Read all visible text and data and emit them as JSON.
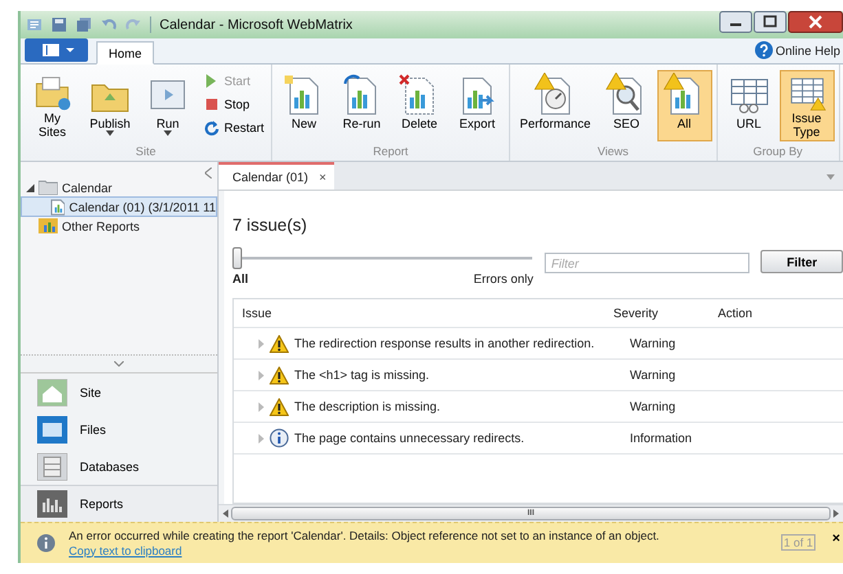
{
  "window": {
    "title": "Calendar - Microsoft WebMatrix"
  },
  "ribbon": {
    "tabs": [
      {
        "label": "Home",
        "selected": true
      }
    ],
    "help": "Online Help",
    "groups": [
      {
        "label": "Site",
        "items": [
          {
            "label": "My Sites",
            "kind": "large",
            "selected": false,
            "disabled": false,
            "dropdown": false
          },
          {
            "label": "Publish",
            "kind": "large",
            "selected": false,
            "disabled": false,
            "dropdown": true
          },
          {
            "label": "Run",
            "kind": "large",
            "selected": false,
            "disabled": false,
            "dropdown": true
          },
          {
            "label": "Start",
            "kind": "small",
            "disabled": true
          },
          {
            "label": "Stop",
            "kind": "small",
            "disabled": false
          },
          {
            "label": "Restart",
            "kind": "small",
            "disabled": false
          }
        ]
      },
      {
        "label": "Report",
        "items": [
          {
            "label": "New",
            "kind": "large",
            "selected": false,
            "disabled": false,
            "dropdown": false
          },
          {
            "label": "Re-run",
            "kind": "large",
            "selected": false,
            "disabled": false,
            "dropdown": false
          },
          {
            "label": "Delete",
            "kind": "large",
            "selected": false,
            "disabled": false,
            "dropdown": false
          },
          {
            "label": "Export",
            "kind": "large",
            "selected": false,
            "disabled": false,
            "dropdown": false
          }
        ]
      },
      {
        "label": "Views",
        "items": [
          {
            "label": "Performance",
            "kind": "large",
            "selected": false,
            "disabled": false,
            "dropdown": false
          },
          {
            "label": "SEO",
            "kind": "large",
            "selected": false,
            "disabled": false,
            "dropdown": false
          },
          {
            "label": "All",
            "kind": "large",
            "selected": true,
            "disabled": false,
            "dropdown": false
          }
        ]
      },
      {
        "label": "Group By",
        "items": [
          {
            "label": "URL",
            "kind": "large",
            "selected": false,
            "disabled": false,
            "dropdown": false
          },
          {
            "label": "Issue Type",
            "kind": "large",
            "selected": true,
            "disabled": false,
            "dropdown": false
          }
        ]
      }
    ]
  },
  "sidebar": {
    "tree": [
      {
        "label": "Calendar",
        "expanded": true,
        "selected": false,
        "children": [
          {
            "label": "Calendar (01) (3/1/2011 11",
            "selected": true
          }
        ]
      },
      {
        "label": "Other Reports",
        "selected": false
      }
    ],
    "nav": [
      {
        "label": "Site",
        "selected": false
      },
      {
        "label": "Files",
        "selected": false
      },
      {
        "label": "Databases",
        "selected": false
      },
      {
        "label": "Reports",
        "selected": true
      }
    ]
  },
  "document_tabs": [
    {
      "label": "Calendar (01)",
      "selected": true,
      "close": "×"
    }
  ],
  "report": {
    "count": "7 issue(s)",
    "slider": {
      "level": 0,
      "min_label": "All",
      "max_label": "Errors only"
    },
    "filter": {
      "placeholder": "Filter"
    },
    "filter_button": "Filter",
    "table": {
      "columns": [
        "Issue",
        "Severity",
        "Action"
      ],
      "rows": [
        {
          "kind": "warning",
          "issue": "The redirection response results in another redirection.",
          "severity": "Warning"
        },
        {
          "kind": "warning",
          "issue": "The <h1> tag is missing.",
          "severity": "Warning"
        },
        {
          "kind": "warning",
          "issue": "The description is missing.",
          "severity": "Warning"
        },
        {
          "kind": "info",
          "issue": "The page contains unnecessary redirects.",
          "severity": "Information"
        }
      ]
    }
  },
  "scrollbar_grip": "III",
  "info_bar": {
    "message": "An error occurred while creating the report 'Calendar'. Details: Object reference not set to an instance of an object.",
    "link": "Copy text to clipboard",
    "pager": "1 of 1",
    "close": "×"
  }
}
